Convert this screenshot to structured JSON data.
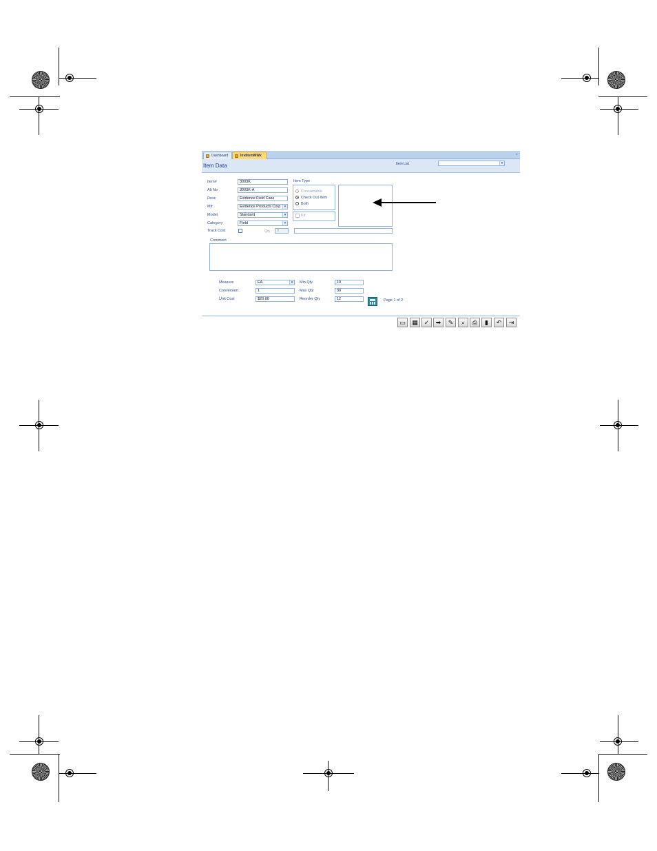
{
  "tabs": [
    {
      "label": "Dashboard",
      "active": false
    },
    {
      "label": "InvtItemMWx",
      "active": true
    }
  ],
  "tab_close_glyph": "×",
  "header": {
    "title": "Item Data",
    "item_list_label": "Item List",
    "item_list_value": ""
  },
  "form": {
    "item_no": {
      "label": "Item#",
      "value": "3003K"
    },
    "alt_no": {
      "label": "Alt No",
      "value": "3003K-A"
    },
    "desc": {
      "label": "Desc",
      "value": "Evidence Field Case"
    },
    "mfr": {
      "label": "Mfr",
      "value": "Evidence Products Corp"
    },
    "model": {
      "label": "Model",
      "value": "Standard"
    },
    "category": {
      "label": "Category",
      "value": "Field"
    },
    "track_cost": {
      "label": "Track Cost",
      "checked": false
    },
    "qty": {
      "label": "Qty",
      "value": "0"
    },
    "item_type": {
      "label": "Item Type",
      "options": [
        "Consumable",
        "Check Out Item",
        "Both"
      ],
      "selected": "Check Out Item"
    },
    "kit": {
      "label": "Kit",
      "checked": false
    },
    "comment": {
      "label": "Comment",
      "value": ""
    },
    "measure": {
      "label": "Measure",
      "value": "EA"
    },
    "conversion": {
      "label": "Conversion",
      "value": "1"
    },
    "unit_cost": {
      "label": "Unit Cost",
      "value": "$20.00"
    },
    "min_qty": {
      "label": "Min Qty",
      "value": "10"
    },
    "max_qty": {
      "label": "Max Qty",
      "value": "30"
    },
    "reorder_qty": {
      "label": "Reorder Qty",
      "value": "12"
    },
    "page_label": "Page 1 of 2"
  },
  "toolbar": [
    {
      "name": "new-record-button",
      "icon": "new-record-icon",
      "glyph": "▭"
    },
    {
      "name": "calculator-button",
      "icon": "calculator-icon",
      "glyph": "▦"
    },
    {
      "name": "save-button",
      "icon": "checkmark-icon",
      "glyph": "✓"
    },
    {
      "name": "next-button",
      "icon": "arrow-right-icon",
      "glyph": "➡"
    },
    {
      "name": "edit-button",
      "icon": "edit-icon",
      "glyph": "✎"
    },
    {
      "name": "find-button",
      "icon": "magnifier-icon",
      "glyph": "⌕"
    },
    {
      "name": "print-button",
      "icon": "printer-icon",
      "glyph": "⎙"
    },
    {
      "name": "delete-button",
      "icon": "trash-icon",
      "glyph": "▮"
    },
    {
      "name": "undo-button",
      "icon": "undo-icon",
      "glyph": "↶"
    },
    {
      "name": "exit-button",
      "icon": "exit-door-icon",
      "glyph": "⇥"
    }
  ],
  "colors": {
    "accent": "#1d3d8c",
    "tab_active": "#ffd879",
    "header_bg": "#dbe7f5"
  }
}
